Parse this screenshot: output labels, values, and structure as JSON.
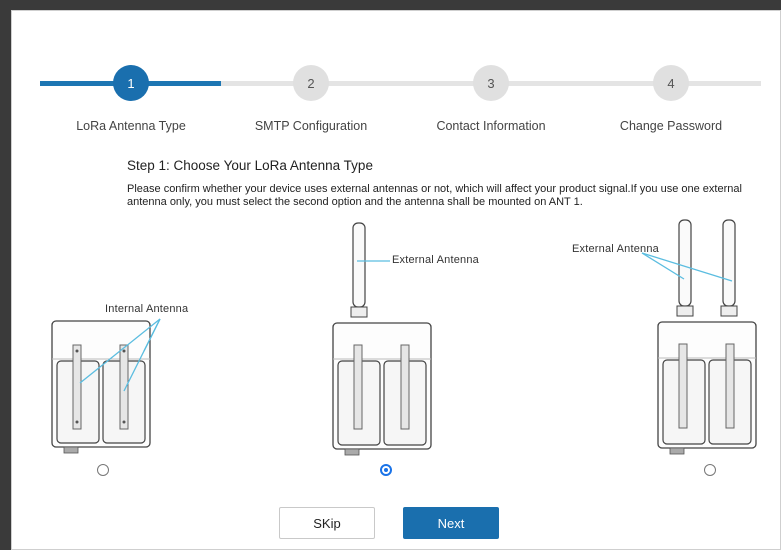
{
  "stepper": {
    "steps": [
      {
        "number": "1",
        "label": "LoRa Antenna Type",
        "active": true
      },
      {
        "number": "2",
        "label": "SMTP Configuration",
        "active": false
      },
      {
        "number": "3",
        "label": "Contact Information",
        "active": false
      },
      {
        "number": "4",
        "label": "Change Password",
        "active": false
      }
    ]
  },
  "content": {
    "title": "Step 1: Choose Your LoRa Antenna Type",
    "description": "Please confirm whether your device uses external antennas or not, which will affect your product signal.If you use one external antenna only, you must select the second option and the antenna shall be mounted on ANT 1."
  },
  "options": [
    {
      "annotation": "Internal Antenna",
      "selected": false
    },
    {
      "annotation": "External Antenna",
      "selected": true
    },
    {
      "annotation": "External Antenna",
      "selected": false
    }
  ],
  "buttons": {
    "skip_label": "SKip",
    "next_label": "Next"
  },
  "colors": {
    "accent": "#1a6fae",
    "callout_line": "#5bbde0"
  }
}
